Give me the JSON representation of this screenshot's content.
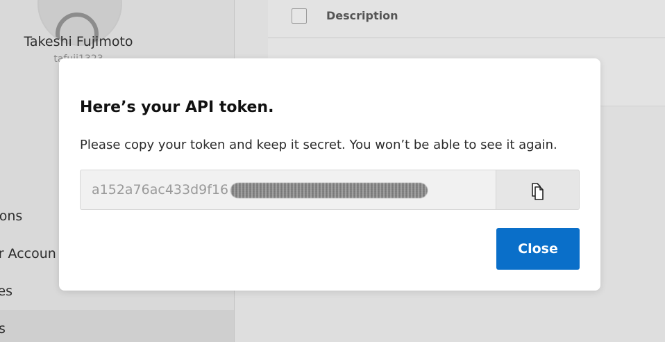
{
  "sidebar": {
    "user": {
      "name": "Takeshi Fujimoto",
      "handle": "tafuji1323"
    },
    "items": [
      {
        "label": "tions"
      },
      {
        "label": "er Accoun"
      },
      {
        "label": "ces"
      },
      {
        "label": "ns"
      }
    ]
  },
  "table": {
    "columns": [
      {
        "label": "Description"
      }
    ]
  },
  "modal": {
    "title": "Here’s your API token.",
    "message": "Please copy your token and keep it secret. You won’t be able to see it again.",
    "token_visible": "a152a76ac433d9f16",
    "copy_icon": "copy-icon",
    "close_label": "Close"
  },
  "colors": {
    "primary": "#0a6fc9",
    "overlay": "#dedede"
  }
}
